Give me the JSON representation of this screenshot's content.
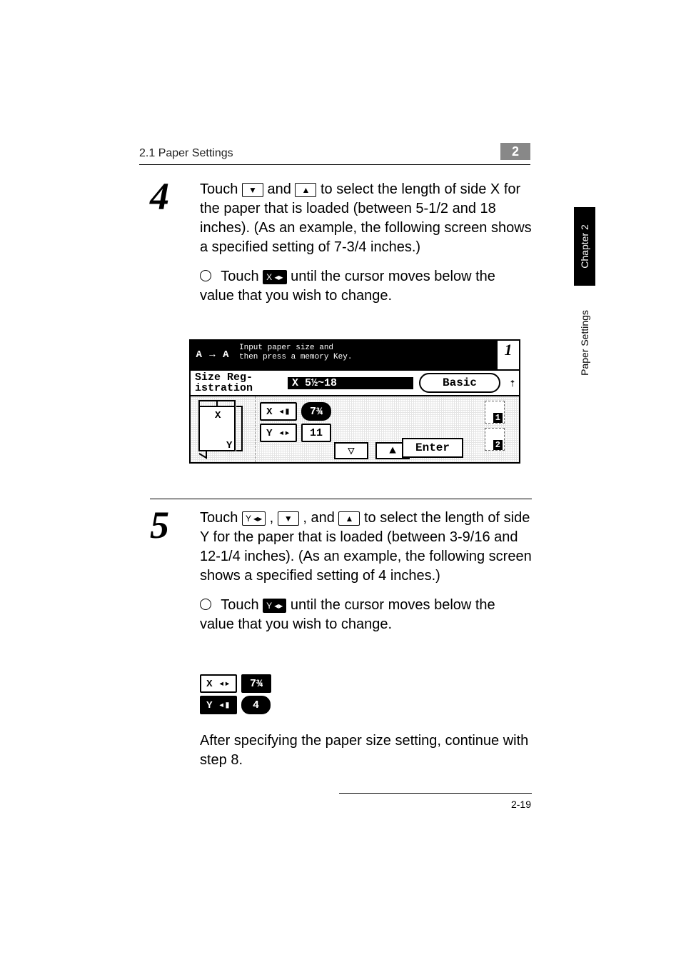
{
  "header": {
    "section": "2.1 Paper Settings",
    "chapter_badge": "2"
  },
  "side_tab": {
    "top": "Chapter 2",
    "bottom": "Paper Settings"
  },
  "step4": {
    "num": "4",
    "text_a": "Touch ",
    "text_b": " and ",
    "text_c": " to select the length of side X for the paper that is loaded (between 5-1/2 and 18 inches). (As an example, the following screen shows a specified setting of 7-3/4 inches.)",
    "sub_a": "Touch ",
    "sub_b": " until the cursor moves below the value that you wish to change.",
    "icon_down": "▼",
    "icon_up": "▲",
    "icon_x": "X ◂▸"
  },
  "panel": {
    "ablock": "A → A",
    "msg1": "Input paper size and",
    "msg2": "then press a memory Key.",
    "page": "1",
    "size_label1": "Size Reg-",
    "size_label2": "istration",
    "xrange": "X 5½~18",
    "basic": "Basic",
    "x_label": "X ◂▮",
    "x_val": "7¾",
    "y_label": "Y ◂▸",
    "y_val": "11",
    "slot1": "1",
    "slot2": "2",
    "arrow_down": "▽",
    "arrow_up": "▲",
    "enter": "Enter"
  },
  "step5": {
    "num": "5",
    "text_a": "Touch ",
    "text_b": " , ",
    "text_c": " , and ",
    "text_d": " to select the length of side Y for the paper that is loaded (between 3-9/16 and 12-1/4 inches). (As an example, the following screen shows a specified setting of 4 inches.)",
    "sub_a": "Touch ",
    "sub_b": " until the cursor moves below the value that you wish to change.",
    "icon_y": "Y ◂▸",
    "icon_down": "▼",
    "icon_up": "▲",
    "icon_y_dark": "Y ◂▸"
  },
  "mini": {
    "x_label": "X ◂▸",
    "x_val": "7¾",
    "y_label": "Y ◂▮",
    "y_val": "4"
  },
  "after_text": "After specifying the paper size setting, continue with step 8.",
  "page_number": "2-19"
}
